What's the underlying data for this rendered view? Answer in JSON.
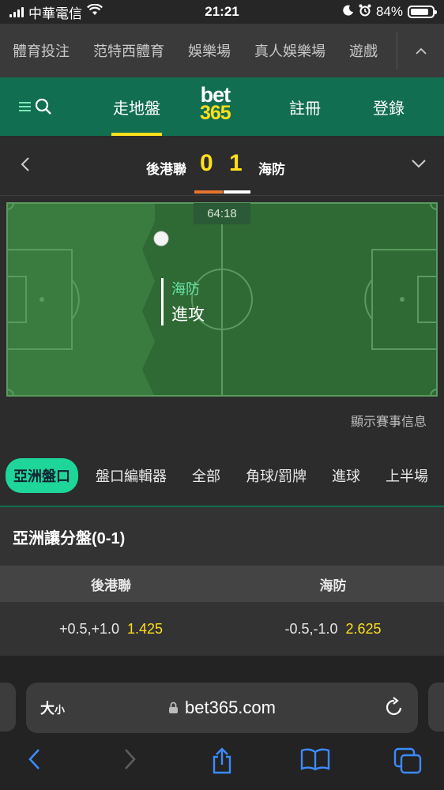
{
  "status_bar": {
    "carrier": "中華電信",
    "time": "21:21",
    "battery_percent": "84%",
    "battery_level": 0.84,
    "icons": [
      "signal-icon",
      "wifi-icon",
      "moon-icon",
      "alarm-icon",
      "battery-icon"
    ]
  },
  "top_nav": {
    "items": [
      "體育投注",
      "范特西體育",
      "娛樂場",
      "真人娛樂場",
      "遊戲"
    ],
    "collapse_icon": "chevron-up-icon"
  },
  "header": {
    "menu_icon": "menu-icon",
    "search_icon": "search-icon",
    "live_label": "走地盤",
    "logo_line1": "bet",
    "logo_line2": "365",
    "register_label": "註冊",
    "login_label": "登錄",
    "brand_color": "#126e51",
    "accent_color": "#ffdf1b"
  },
  "scoreboard": {
    "home_team": "後港聯",
    "away_team": "海防",
    "home_score": "0",
    "away_score": "1",
    "home_color": "#e8742b",
    "away_color": "#ffffff"
  },
  "pitch": {
    "clock": "64:18",
    "attacking_team": "海防",
    "state": "進攻",
    "show_info_label": "顯示賽事信息"
  },
  "market_tabs": {
    "items": [
      "亞洲盤口",
      "盤口編輯器",
      "全部",
      "角球/罰牌",
      "進球",
      "上半場"
    ],
    "active": "亞洲盤口"
  },
  "market": {
    "title": "亞洲讓分盤(0-1)",
    "columns": [
      "後港聯",
      "海防"
    ],
    "rows": [
      {
        "home_line": "+0.5,+1.0",
        "home_odds": "1.425",
        "away_line": "-0.5,-1.0",
        "away_odds": "2.625"
      }
    ]
  },
  "browser": {
    "text_size_label": "大",
    "text_size_small": "小",
    "url": "bet365.com",
    "toolbar_icons": [
      "back-icon",
      "forward-icon",
      "share-icon",
      "bookmarks-icon",
      "tabs-icon"
    ]
  }
}
